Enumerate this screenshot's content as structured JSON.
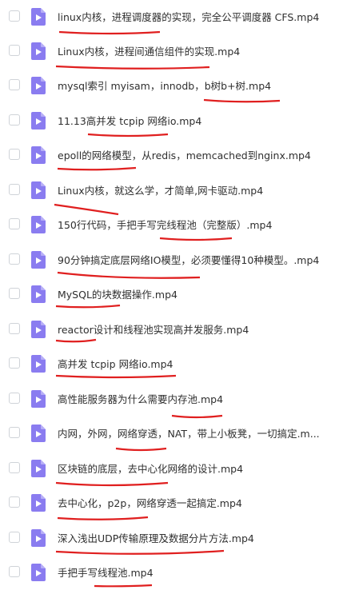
{
  "files": [
    {
      "name": "linux内核，进程调度器的实现，完全公平调度器 CFS.mp4"
    },
    {
      "name": "Linux内核，进程间通信组件的实现.mp4"
    },
    {
      "name": "mysql索引 myisam，innodb，b树b+树.mp4"
    },
    {
      "name": "11.13高并发 tcpip 网络io.mp4"
    },
    {
      "name": "epoll的网络模型，从redis，memcached到nginx.mp4"
    },
    {
      "name": "Linux内核，就这么学，才简单,网卡驱动.mp4"
    },
    {
      "name": "150行代码，手把手写完线程池（完整版）.mp4"
    },
    {
      "name": "90分钟搞定底层网络IO模型，必须要懂得10种模型。.mp4"
    },
    {
      "name": "MySQL的块数据操作.mp4"
    },
    {
      "name": "reactor设计和线程池实现高并发服务.mp4"
    },
    {
      "name": "高并发 tcpip 网络io.mp4"
    },
    {
      "name": "高性能服务器为什么需要内存池.mp4"
    },
    {
      "name": "内网，外网，网络穿透，NAT，带上小板凳，一切搞定.m..."
    },
    {
      "name": "区块链的底层，去中心化网络的设计.mp4"
    },
    {
      "name": "去中心化，p2p，网络穿透一起搞定.mp4"
    },
    {
      "name": "深入浅出UDP传输原理及数据分片方法.mp4"
    },
    {
      "name": "手把手写线程池.mp4"
    }
  ],
  "colors": {
    "icon": "#8a7cf0",
    "annotation": "#e01f1f"
  }
}
